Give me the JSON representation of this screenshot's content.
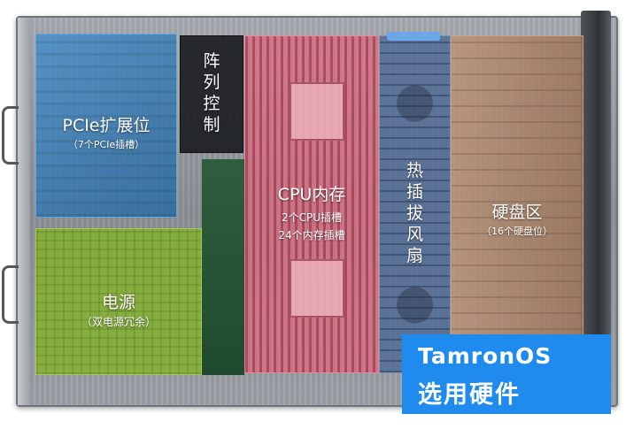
{
  "zones": {
    "pcie": {
      "title": "PCIe扩展位",
      "subtitle": "（7个PCIe插槽）"
    },
    "raid": {
      "chars": [
        "阵",
        "列",
        "控",
        "制"
      ]
    },
    "cpu": {
      "title": "CPU内存",
      "line1": "2个CPU插槽",
      "line2": "24个内存插槽"
    },
    "fan": {
      "chars": [
        "热",
        "插",
        "拔",
        "风",
        "扇"
      ]
    },
    "hdd": {
      "title": "硬盘区",
      "subtitle": "（16个硬盘位）"
    },
    "psu": {
      "title": "电源",
      "subtitle": "（双电源冗余）"
    }
  },
  "badge": {
    "title": "TamronOS",
    "subtitle": "选用硬件"
  },
  "colors": {
    "pcie": "#2e80c4",
    "raid": "#1c1e22",
    "cpu": "#d6566e",
    "fan": "#526c96",
    "hdd": "#b28464",
    "psu": "#84b02e",
    "badge": "#1f8bef"
  }
}
